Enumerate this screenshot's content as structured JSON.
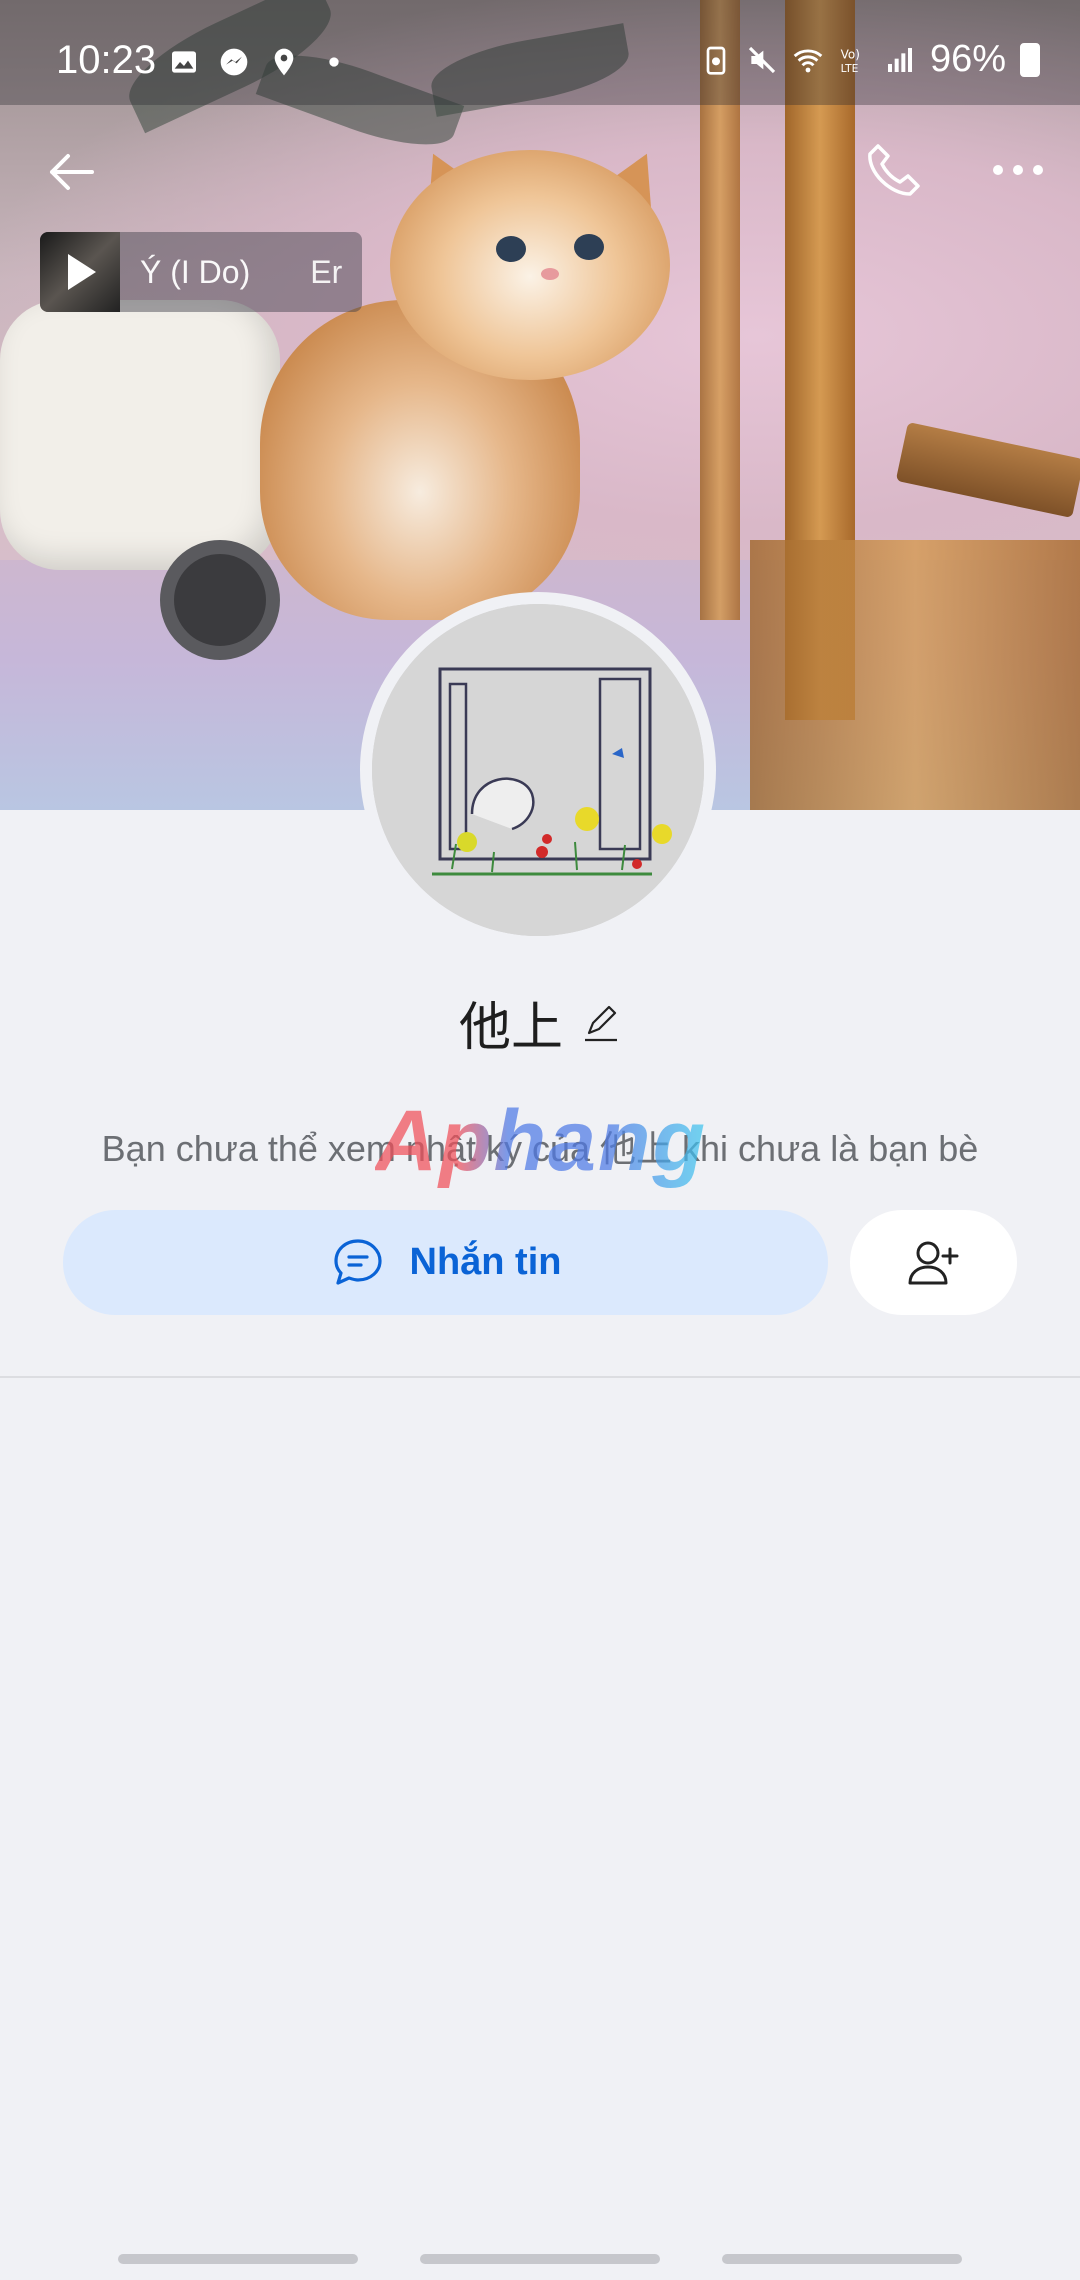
{
  "status_bar": {
    "time": "10:23",
    "battery": "96%",
    "left_icons": [
      "image-icon",
      "messenger-icon",
      "location-icon",
      "dot-icon"
    ],
    "right_icons": [
      "battery-saver-icon",
      "mute-icon",
      "wifi-icon",
      "volte-icon",
      "signal-icon"
    ]
  },
  "header": {
    "back_icon": "arrow-left-icon",
    "call_icon": "phone-icon",
    "more_icon": "more-horizontal-icon"
  },
  "music": {
    "title": "Ý (I Do)",
    "extra": "Er",
    "play_icon": "play-icon"
  },
  "profile": {
    "name": "他上",
    "edit_icon": "pencil-icon",
    "info_text": "Bạn chưa thể xem nhật ký của 他上 khi chưa là bạn bè",
    "watermark": "Aphang"
  },
  "actions": {
    "message_label": "Nhắn tin",
    "message_icon": "chat-bubble-icon",
    "add_friend_icon": "user-add-icon"
  },
  "colors": {
    "accent": "#0a63d6",
    "message_button_bg": "#dbe9fd",
    "page_bg": "#f0f1f5"
  }
}
